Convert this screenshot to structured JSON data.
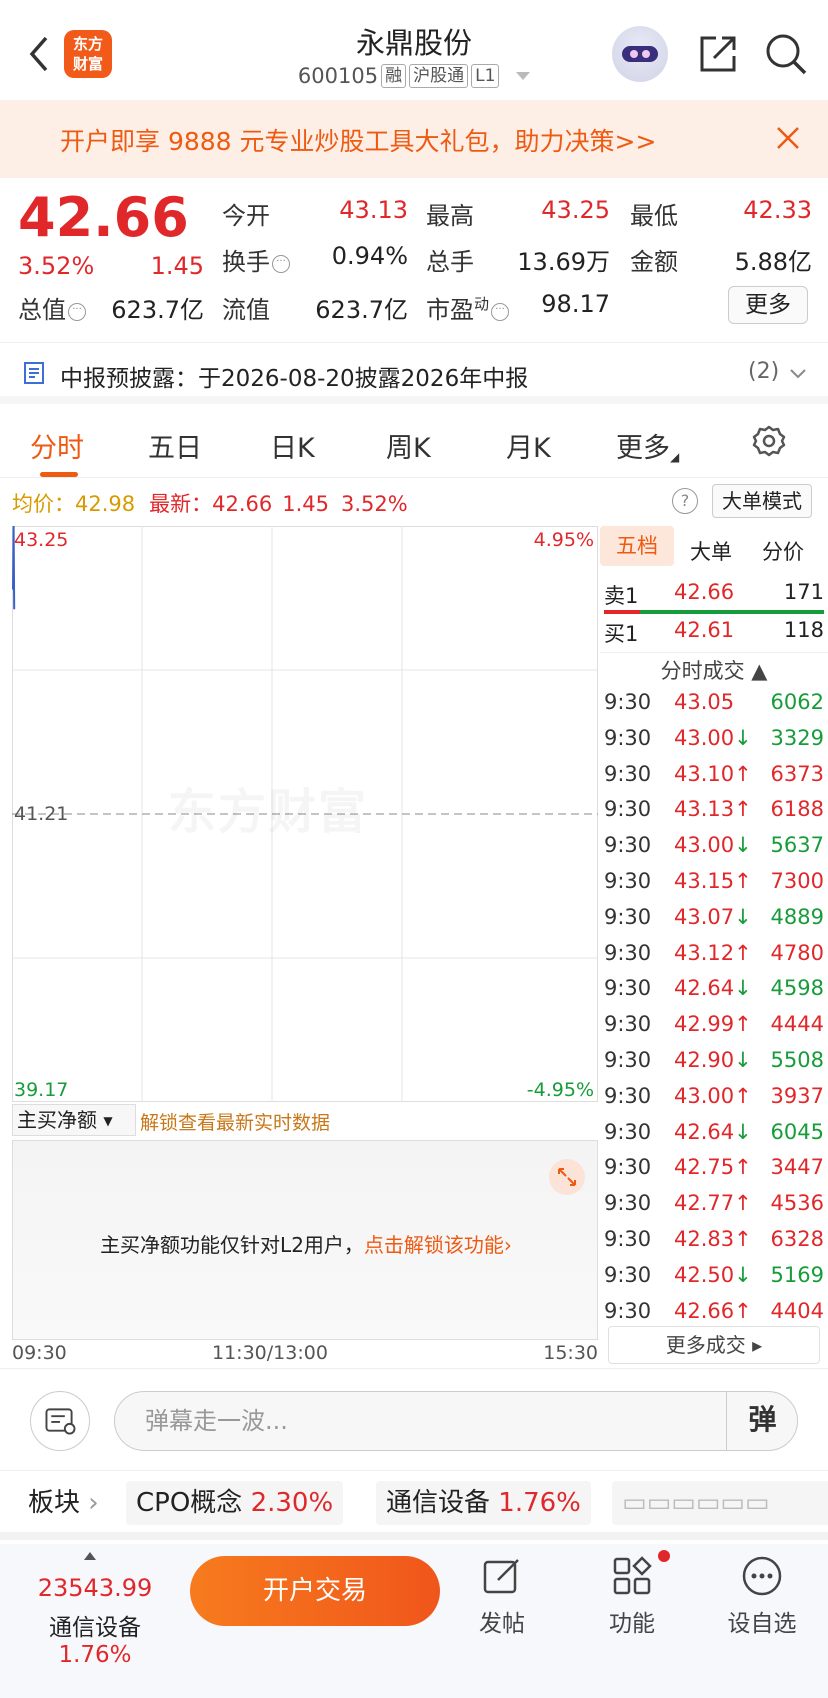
{
  "header": {
    "logo": "东方财富",
    "title": "永鼎股份",
    "code": "600105",
    "tags": [
      "融",
      "沪股通",
      "L1"
    ]
  },
  "banner": {
    "text": "开户即享 9888 元专业炒股工具大礼包，助力决策>>"
  },
  "quote": {
    "price": "42.66",
    "pct": "3.52%",
    "chg": "1.45",
    "fields": [
      {
        "label": "今开",
        "value": "43.13",
        "color": "red"
      },
      {
        "label": "最高",
        "value": "43.25",
        "color": "red"
      },
      {
        "label": "最低",
        "value": "42.33",
        "color": "red"
      },
      {
        "label": "换手",
        "value": "0.94%",
        "color": "black"
      },
      {
        "label": "总手",
        "value": "13.69万",
        "color": "black"
      },
      {
        "label": "金额",
        "value": "5.88亿",
        "color": "black"
      },
      {
        "label": "总值",
        "value": "623.7亿",
        "color": "black"
      },
      {
        "label": "流值",
        "value": "623.7亿",
        "color": "black"
      },
      {
        "label": "市盈",
        "value": "98.17",
        "color": "black"
      }
    ],
    "pe_sup": "动",
    "more": "更多"
  },
  "disclosure": {
    "text": "中报预披露：于2026-08-20披露2026年中报",
    "count": "(2)"
  },
  "tabs": [
    "分时",
    "五日",
    "日K",
    "周K",
    "月K",
    "更多"
  ],
  "avgline": {
    "avg_label": "均价：",
    "avg": "42.98",
    "latest_label": "最新：",
    "latest": "42.66",
    "chg": "1.45",
    "pct": "3.52%"
  },
  "help": "?",
  "bigmode": "大单模式",
  "watermark": "东方财富",
  "chart_data": {
    "type": "line",
    "title": "",
    "xlabel": "",
    "ylabel": "",
    "ylim": [
      39.17,
      43.25
    ],
    "pre_close": "41.21",
    "y_labels": {
      "top": "43.25",
      "mid": "41.21",
      "bottom": "39.17"
    },
    "pct_labels": {
      "top": "4.95%",
      "bottom": "-4.95%"
    },
    "x_ticks": [
      "09:30",
      "11:30/13:00",
      "15:30"
    ],
    "series": [
      {
        "x": [
          "09:30",
          "09:30",
          "09:31"
        ],
        "values": [
          42.8,
          43.25,
          42.66
        ]
      }
    ]
  },
  "flow": {
    "select": "主买净额",
    "link": "解锁查看最新实时数据",
    "msg": "主买净额功能仅针对L2用户，",
    "msg_link": "点击解锁该功能›"
  },
  "side": {
    "tabs": [
      "五档",
      "大单",
      "分价"
    ],
    "sell": {
      "label": "卖1",
      "price": "42.66",
      "vol": "171"
    },
    "buy": {
      "label": "买1",
      "price": "42.61",
      "vol": "118"
    },
    "ticks_title": "分时成交 ▲",
    "ticks": [
      {
        "t": "9:30",
        "p": "43.05",
        "a": "",
        "v": "6062",
        "c": "green"
      },
      {
        "t": "9:30",
        "p": "43.00",
        "a": "↓",
        "v": "3329",
        "c": "green"
      },
      {
        "t": "9:30",
        "p": "43.10",
        "a": "↑",
        "v": "6373",
        "c": "red"
      },
      {
        "t": "9:30",
        "p": "43.13",
        "a": "↑",
        "v": "6188",
        "c": "red"
      },
      {
        "t": "9:30",
        "p": "43.00",
        "a": "↓",
        "v": "5637",
        "c": "green"
      },
      {
        "t": "9:30",
        "p": "43.15",
        "a": "↑",
        "v": "7300",
        "c": "red"
      },
      {
        "t": "9:30",
        "p": "43.07",
        "a": "↓",
        "v": "4889",
        "c": "green"
      },
      {
        "t": "9:30",
        "p": "43.12",
        "a": "↑",
        "v": "4780",
        "c": "red"
      },
      {
        "t": "9:30",
        "p": "42.64",
        "a": "↓",
        "v": "4598",
        "c": "green"
      },
      {
        "t": "9:30",
        "p": "42.99",
        "a": "↑",
        "v": "4444",
        "c": "red"
      },
      {
        "t": "9:30",
        "p": "42.90",
        "a": "↓",
        "v": "5508",
        "c": "green"
      },
      {
        "t": "9:30",
        "p": "43.00",
        "a": "↑",
        "v": "3937",
        "c": "red"
      },
      {
        "t": "9:30",
        "p": "42.64",
        "a": "↓",
        "v": "6045",
        "c": "green"
      },
      {
        "t": "9:30",
        "p": "42.75",
        "a": "↑",
        "v": "3447",
        "c": "red"
      },
      {
        "t": "9:30",
        "p": "42.77",
        "a": "↑",
        "v": "4536",
        "c": "red"
      },
      {
        "t": "9:30",
        "p": "42.83",
        "a": "↑",
        "v": "6328",
        "c": "red"
      },
      {
        "t": "9:30",
        "p": "42.50",
        "a": "↓",
        "v": "5169",
        "c": "green"
      },
      {
        "t": "9:30",
        "p": "42.66",
        "a": "↑",
        "v": "4404",
        "c": "red"
      }
    ],
    "more": "更多成交 ▸"
  },
  "danmu": {
    "placeholder": "弹幕走一波...",
    "btn": "弹"
  },
  "sectors": {
    "label": "板块",
    "items": [
      {
        "name": "CPO概念",
        "pct": "2.30%"
      },
      {
        "name": "通信设备",
        "pct": "1.76%"
      }
    ]
  },
  "bottom": {
    "index_value": "23543.99",
    "index_name": "通信设备",
    "index_pct": "1.76%",
    "open": "开户交易",
    "nav": [
      "发帖",
      "功能",
      "设自选"
    ]
  }
}
